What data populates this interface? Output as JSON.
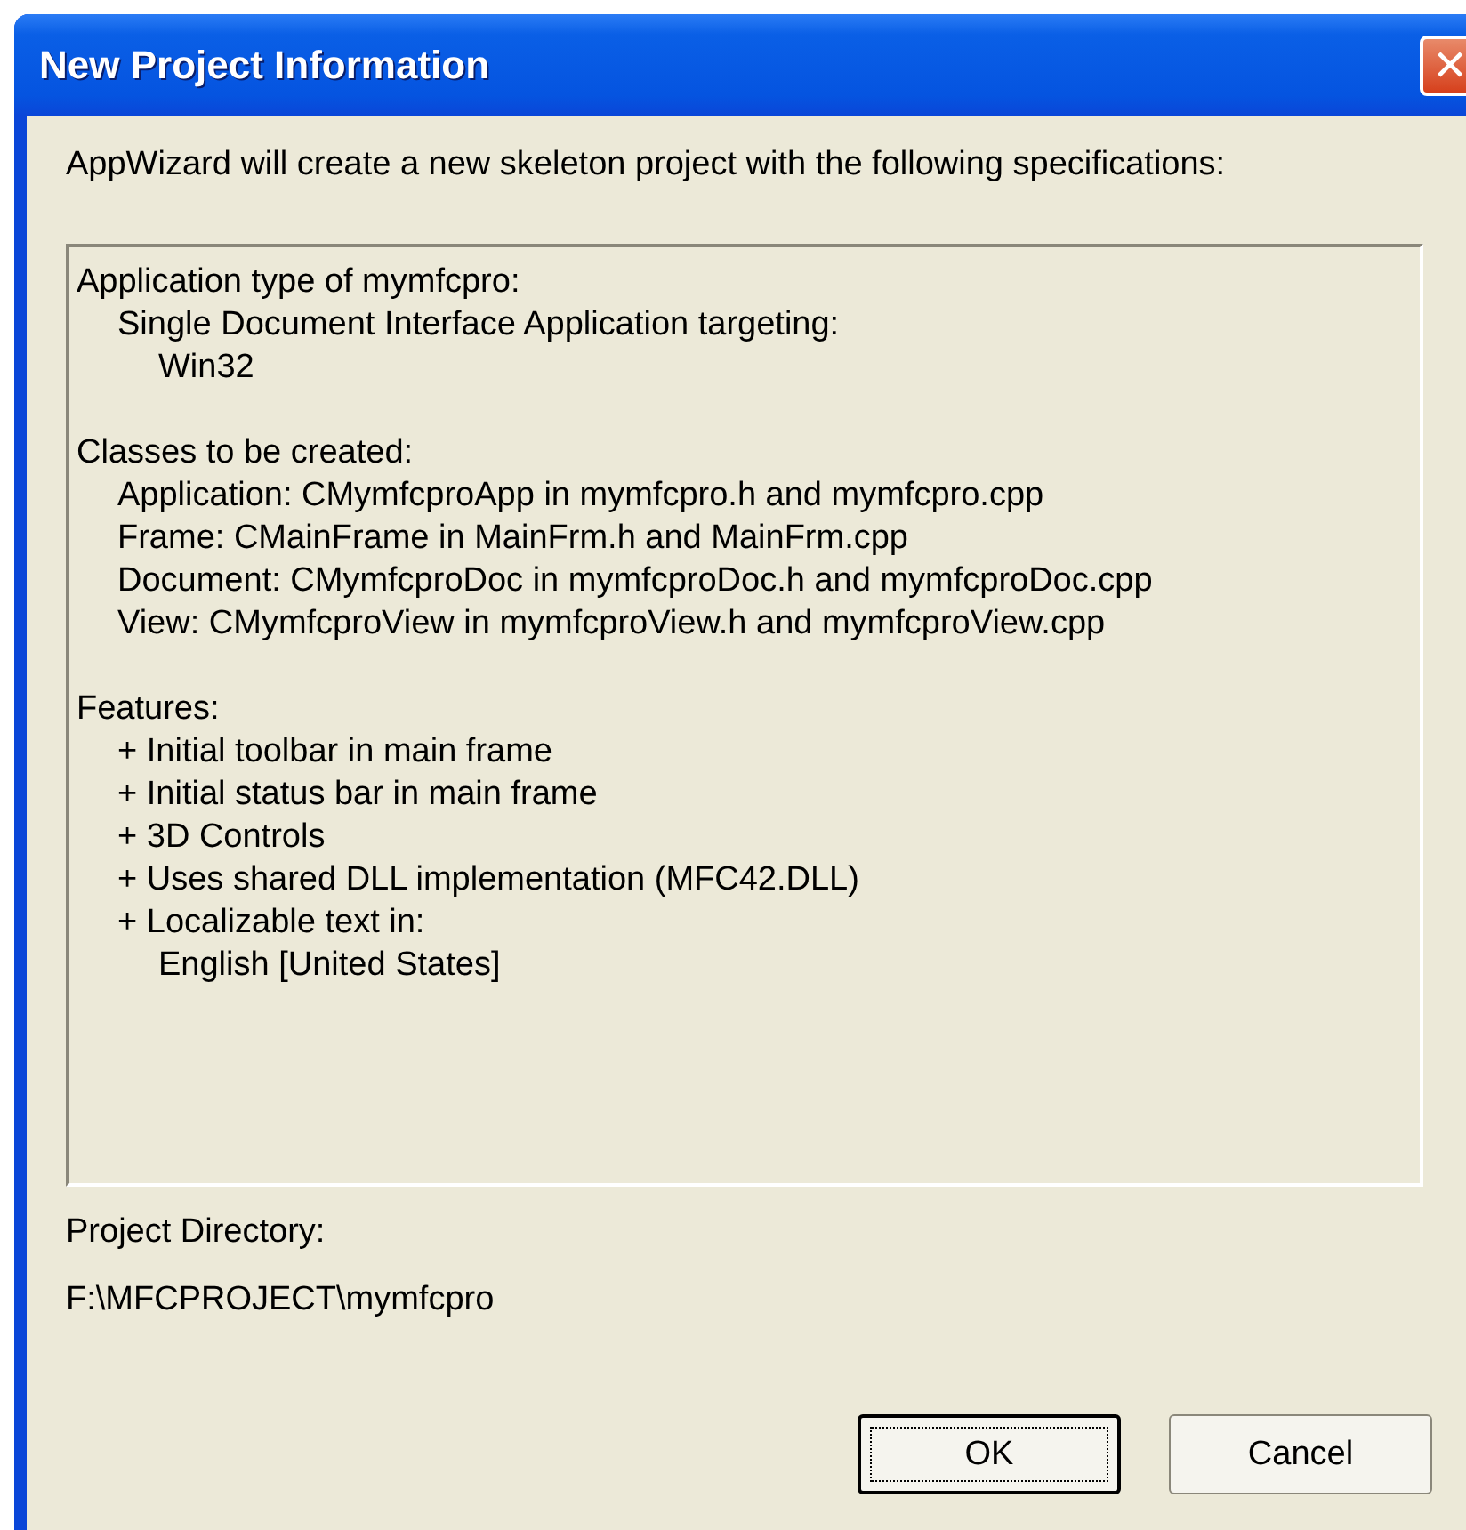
{
  "window": {
    "title": "New Project Information",
    "close_glyph": "✕"
  },
  "intro": "AppWizard will create a new skeleton project with the following specifications:",
  "spec_lines": [
    {
      "text": "Application type of mymfcpro:",
      "children": [
        {
          "text": "Single Document Interface Application targeting:",
          "children": [
            {
              "text": "Win32"
            }
          ]
        }
      ]
    },
    {
      "text": "Classes to be created:",
      "children": [
        {
          "text": "Application: CMymfcproApp in mymfcpro.h and mymfcpro.cpp"
        },
        {
          "text": "Frame: CMainFrame in MainFrm.h and MainFrm.cpp"
        },
        {
          "text": "Document: CMymfcproDoc in mymfcproDoc.h and mymfcproDoc.cpp"
        },
        {
          "text": "View: CMymfcproView in mymfcproView.h and mymfcproView.cpp"
        }
      ]
    },
    {
      "text": "Features:",
      "children": [
        {
          "text": "+ Initial toolbar in main frame"
        },
        {
          "text": "+ Initial status bar in main frame"
        },
        {
          "text": "+ 3D Controls"
        },
        {
          "text": "+ Uses shared DLL implementation (MFC42.DLL)"
        },
        {
          "text": "+ Localizable text in:",
          "children": [
            {
              "text": "English [United States]"
            }
          ]
        }
      ]
    }
  ],
  "directory_label": "Project Directory:",
  "directory_value": "F:\\MFCPROJECT\\mymfcpro",
  "buttons": [
    {
      "label": "OK",
      "default": true
    },
    {
      "label": "Cancel",
      "default": false
    }
  ]
}
